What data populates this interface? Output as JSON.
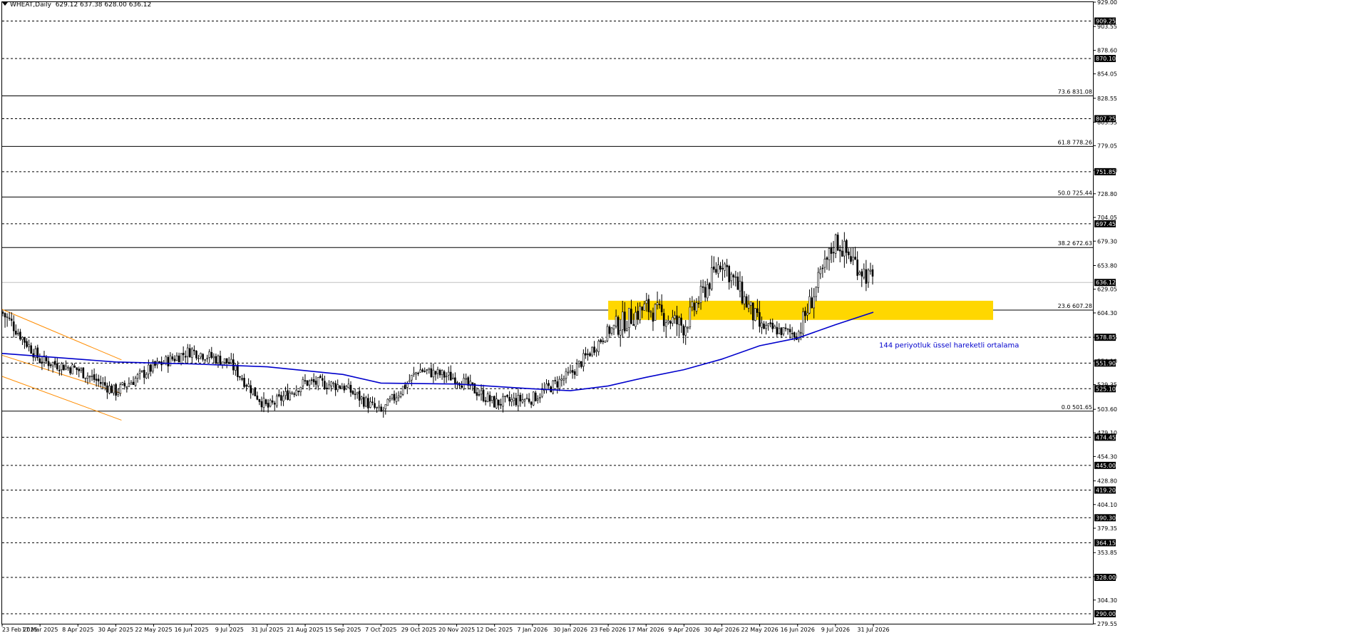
{
  "header": {
    "symbol": "WHEAT,Daily",
    "ohlc": "629.12 637.38 628.00 636.12"
  },
  "colors": {
    "ema": "#0000cc",
    "zone": "#ffd700",
    "channel": "#ff8c00",
    "candle": "#000000",
    "label_bg": "#000000"
  },
  "chart_data": {
    "type": "candlestick",
    "ylim": [
      279.55,
      929.0
    ],
    "y_ticks": [
      929.0,
      903.55,
      878.6,
      854.05,
      828.55,
      803.55,
      779.05,
      753.3,
      728.8,
      704.05,
      679.3,
      653.8,
      629.05,
      604.3,
      578.85,
      554.1,
      529.35,
      503.6,
      479.1,
      454.3,
      428.8,
      404.1,
      379.35,
      353.85,
      328.8,
      304.3,
      279.55
    ],
    "x_ticks": [
      "23 Feb 2025",
      "17 Mar 2025",
      "8 Apr 2025",
      "30 Apr 2025",
      "22 May 2025",
      "16 Jun 2025",
      "9 Jul 2025",
      "31 Jul 2025",
      "21 Aug 2025",
      "15 Sep 2025",
      "7 Oct 2025",
      "29 Oct 2025",
      "20 Nov 2025",
      "12 Dec 2025",
      "7 Jan 2026",
      "30 Jan 2026",
      "23 Feb 2026",
      "17 Mar 2026",
      "9 Apr 2026",
      "30 Apr 2026",
      "22 May 2026",
      "16 Jun 2026",
      "9 Jul 2026",
      "31 Jul 2026"
    ],
    "horizontal_levels": [
      909.25,
      870.1,
      807.25,
      751.85,
      697.45,
      578.85,
      551.9,
      525.1,
      474.45,
      445.0,
      419.2,
      390.3,
      364.15,
      328.0,
      290.0
    ],
    "current_price": 636.12,
    "fibonacci": [
      {
        "label": "73.6 831.08",
        "value": 831.08
      },
      {
        "label": "61.8 778.26",
        "value": 778.26
      },
      {
        "label": "50.0 725.44",
        "value": 725.44
      },
      {
        "label": "38.2 672.63",
        "value": 672.63
      },
      {
        "label": "23.6 607.28",
        "value": 607.28
      },
      {
        "label": "0.0 501.65",
        "value": 501.65
      }
    ],
    "zone": {
      "from_date": "23 Feb 2026",
      "top": 617,
      "bottom": 597
    },
    "ema_label": "144 periyotluk üssel hareketli ortalama",
    "ema": [
      {
        "date": "23 Feb 2025",
        "value": 562
      },
      {
        "date": "30 Apr 2025",
        "value": 553
      },
      {
        "date": "16 Jun 2025",
        "value": 551
      },
      {
        "date": "31 Jul 2025",
        "value": 548
      },
      {
        "date": "15 Sep 2025",
        "value": 540
      },
      {
        "date": "7 Oct 2025",
        "value": 531
      },
      {
        "date": "20 Nov 2025",
        "value": 530
      },
      {
        "date": "7 Jan 2026",
        "value": 525
      },
      {
        "date": "30 Jan 2026",
        "value": 523
      },
      {
        "date": "23 Feb 2026",
        "value": 528
      },
      {
        "date": "17 Mar 2026",
        "value": 537
      },
      {
        "date": "9 Apr 2026",
        "value": 545
      },
      {
        "date": "30 Apr 2026",
        "value": 556
      },
      {
        "date": "22 May 2026",
        "value": 570
      },
      {
        "date": "16 Jun 2026",
        "value": 578
      },
      {
        "date": "9 Jul 2026",
        "value": 592
      },
      {
        "date": "31 Jul 2026",
        "value": 605
      }
    ],
    "channel": [
      {
        "from": {
          "date": "23 Feb 2025",
          "value": 608
        },
        "to": {
          "date": "30 Apr 2025",
          "value": 553
        }
      },
      {
        "from": {
          "date": "23 Feb 2025",
          "value": 560
        },
        "to": {
          "date": "30 Apr 2025",
          "value": 518
        }
      },
      {
        "from": {
          "date": "23 Feb 2025",
          "value": 538
        },
        "to": {
          "date": "30 Apr 2025",
          "value": 490
        }
      }
    ],
    "series_path": [
      {
        "date": "23 Feb 2025",
        "value": 605
      },
      {
        "date": "17 Mar 2025",
        "value": 555
      },
      {
        "date": "8 Apr 2025",
        "value": 545
      },
      {
        "date": "30 Apr 2025",
        "value": 522
      },
      {
        "date": "22 May 2025",
        "value": 548
      },
      {
        "date": "16 Jun 2025",
        "value": 565
      },
      {
        "date": "9 Jul 2025",
        "value": 552
      },
      {
        "date": "31 Jul 2025",
        "value": 505
      },
      {
        "date": "21 Aug 2025",
        "value": 532
      },
      {
        "date": "15 Sep 2025",
        "value": 528
      },
      {
        "date": "7 Oct 2025",
        "value": 500
      },
      {
        "date": "29 Oct 2025",
        "value": 545
      },
      {
        "date": "20 Nov 2025",
        "value": 536
      },
      {
        "date": "12 Dec 2025",
        "value": 510
      },
      {
        "date": "7 Jan 2026",
        "value": 515
      },
      {
        "date": "30 Jan 2026",
        "value": 540
      },
      {
        "date": "23 Feb 2026",
        "value": 585
      },
      {
        "date": "17 Mar 2026",
        "value": 610
      },
      {
        "date": "9 Apr 2026",
        "value": 590
      },
      {
        "date": "30 Apr 2026",
        "value": 660
      },
      {
        "date": "22 May 2026",
        "value": 590
      },
      {
        "date": "16 Jun 2026",
        "value": 582
      },
      {
        "date": "9 Jul 2026",
        "value": 680
      },
      {
        "date": "31 Jul 2026",
        "value": 636
      }
    ]
  }
}
